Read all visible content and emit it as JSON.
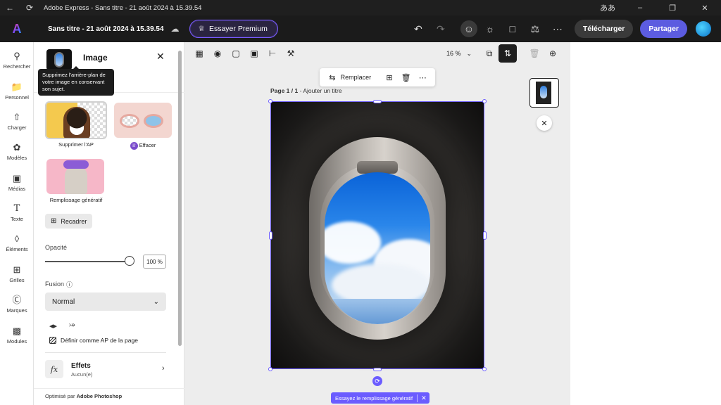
{
  "window": {
    "title": "Adobe Express - Sans titre - 21 août 2024 à 15.39.54",
    "lang_glyph": "ああ"
  },
  "header": {
    "doc_title": "Sans titre - 21 août 2024 à 15.39.54",
    "premium_label": "Essayer Premium",
    "download_label": "Télécharger",
    "share_label": "Partager"
  },
  "rail": {
    "items": [
      {
        "label": "Rechercher",
        "icon": "search-icon"
      },
      {
        "label": "Personnel",
        "icon": "folder-icon"
      },
      {
        "label": "Charger",
        "icon": "upload-icon"
      },
      {
        "label": "Modèles",
        "icon": "templates-icon"
      },
      {
        "label": "Médias",
        "icon": "media-icon"
      },
      {
        "label": "Texte",
        "icon": "text-icon"
      },
      {
        "label": "Éléments",
        "icon": "elements-icon"
      },
      {
        "label": "Grilles",
        "icon": "grids-icon"
      },
      {
        "label": "Marques",
        "icon": "brands-icon"
      },
      {
        "label": "Modules",
        "icon": "modules-icon"
      }
    ]
  },
  "panel": {
    "title": "Image",
    "tooltip": "Supprimez l'arrière-plan de votre image en conservant son sujet.",
    "actions": [
      {
        "label": "Supprimer l'AP"
      },
      {
        "label": "Effacer",
        "premium": true
      },
      {
        "label": "Remplissage génératif"
      }
    ],
    "crop_label": "Recadrer",
    "opacity_label": "Opacité",
    "opacity_value": "100 %",
    "opacity_fraction": 1.0,
    "blend_label": "Fusion",
    "blend_value": "Normal",
    "set_bg_label": "Définir comme AP de la page",
    "effects_title": "Effets",
    "effects_sub": "Aucun(e)",
    "footer": "Optimisé par",
    "footer_brand": "Adobe Photoshop"
  },
  "canvas": {
    "zoom": "16 %",
    "context_replace": "Remplacer",
    "page_label": "Page 1 / 1",
    "page_title_hint": "Ajouter un titre",
    "gen_fill_pill": "Essayez le remplissage génératif"
  },
  "colors": {
    "accent": "#6b5cff",
    "share": "#5c5ce0",
    "appbar": "#1b1b1b"
  }
}
